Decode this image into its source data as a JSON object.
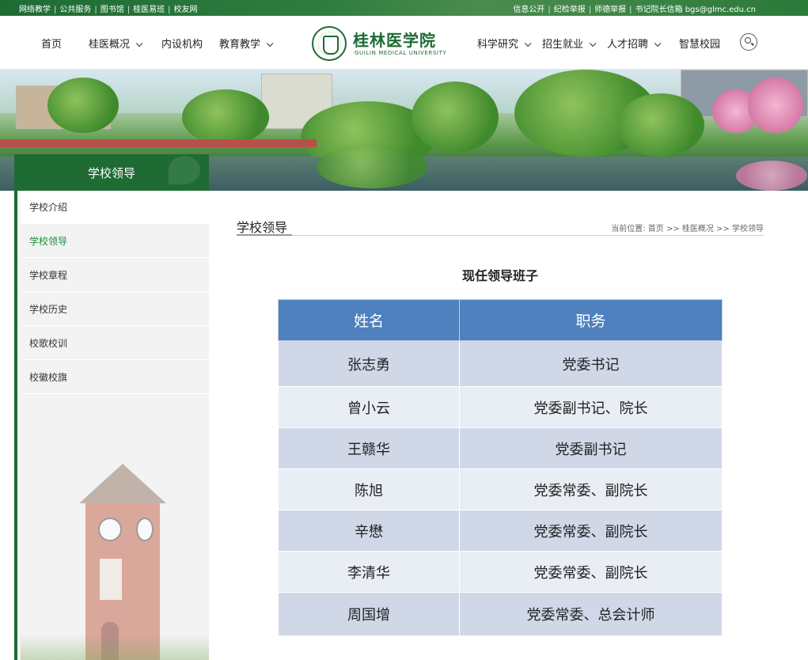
{
  "topbar": {
    "left_links": [
      "网络教学",
      "公共服务",
      "图书馆",
      "桂医易班",
      "校友网"
    ],
    "right_links": [
      "信息公开",
      "纪检举报",
      "师德举报",
      "书记院长信箱 bgs@glmc.edu.cn"
    ]
  },
  "header": {
    "nav_left": [
      {
        "label": "首页",
        "has_dropdown": false
      },
      {
        "label": "桂医概况",
        "has_dropdown": true
      },
      {
        "label": "内设机构",
        "has_dropdown": false
      },
      {
        "label": "教育教学",
        "has_dropdown": true
      }
    ],
    "nav_right": [
      {
        "label": "科学研究",
        "has_dropdown": true
      },
      {
        "label": "招生就业",
        "has_dropdown": true
      },
      {
        "label": "人才招聘",
        "has_dropdown": true
      },
      {
        "label": "智慧校园",
        "has_dropdown": false
      }
    ],
    "logo_cn": "桂林医学院",
    "logo_en": "GUILIN MEDICAL UNIVERSITY",
    "search_icon": "search-icon"
  },
  "sidebar": {
    "title": "学校领导",
    "items": [
      {
        "label": "学校介绍",
        "active": false
      },
      {
        "label": "学校领导",
        "active": true
      },
      {
        "label": "学校章程",
        "active": false
      },
      {
        "label": "学校历史",
        "active": false
      },
      {
        "label": "校歌校训",
        "active": false
      },
      {
        "label": "校徽校旗",
        "active": false
      }
    ]
  },
  "main": {
    "title": "学校领导",
    "breadcrumb": "当前位置: 首页 >> 桂医概况 >> 学校领导",
    "heading": "现任领导班子",
    "table": {
      "headers": [
        "姓名",
        "职务"
      ],
      "rows": [
        [
          "张志勇",
          "党委书记"
        ],
        [
          "曾小云",
          "党委副书记、院长"
        ],
        [
          "王赣华",
          "党委副书记"
        ],
        [
          "陈旭",
          "党委常委、副院长"
        ],
        [
          "辛懋",
          "党委常委、副院长"
        ],
        [
          "李清华",
          "党委常委、副院长"
        ],
        [
          "周国增",
          "党委常委、总会计师"
        ]
      ]
    }
  },
  "colors": {
    "brand_green": "#1e6b34",
    "active_green": "#1e8a3c",
    "table_header_blue": "#4e81bd",
    "row_dark": "#d0d8e8",
    "row_light": "#e9edf4"
  }
}
